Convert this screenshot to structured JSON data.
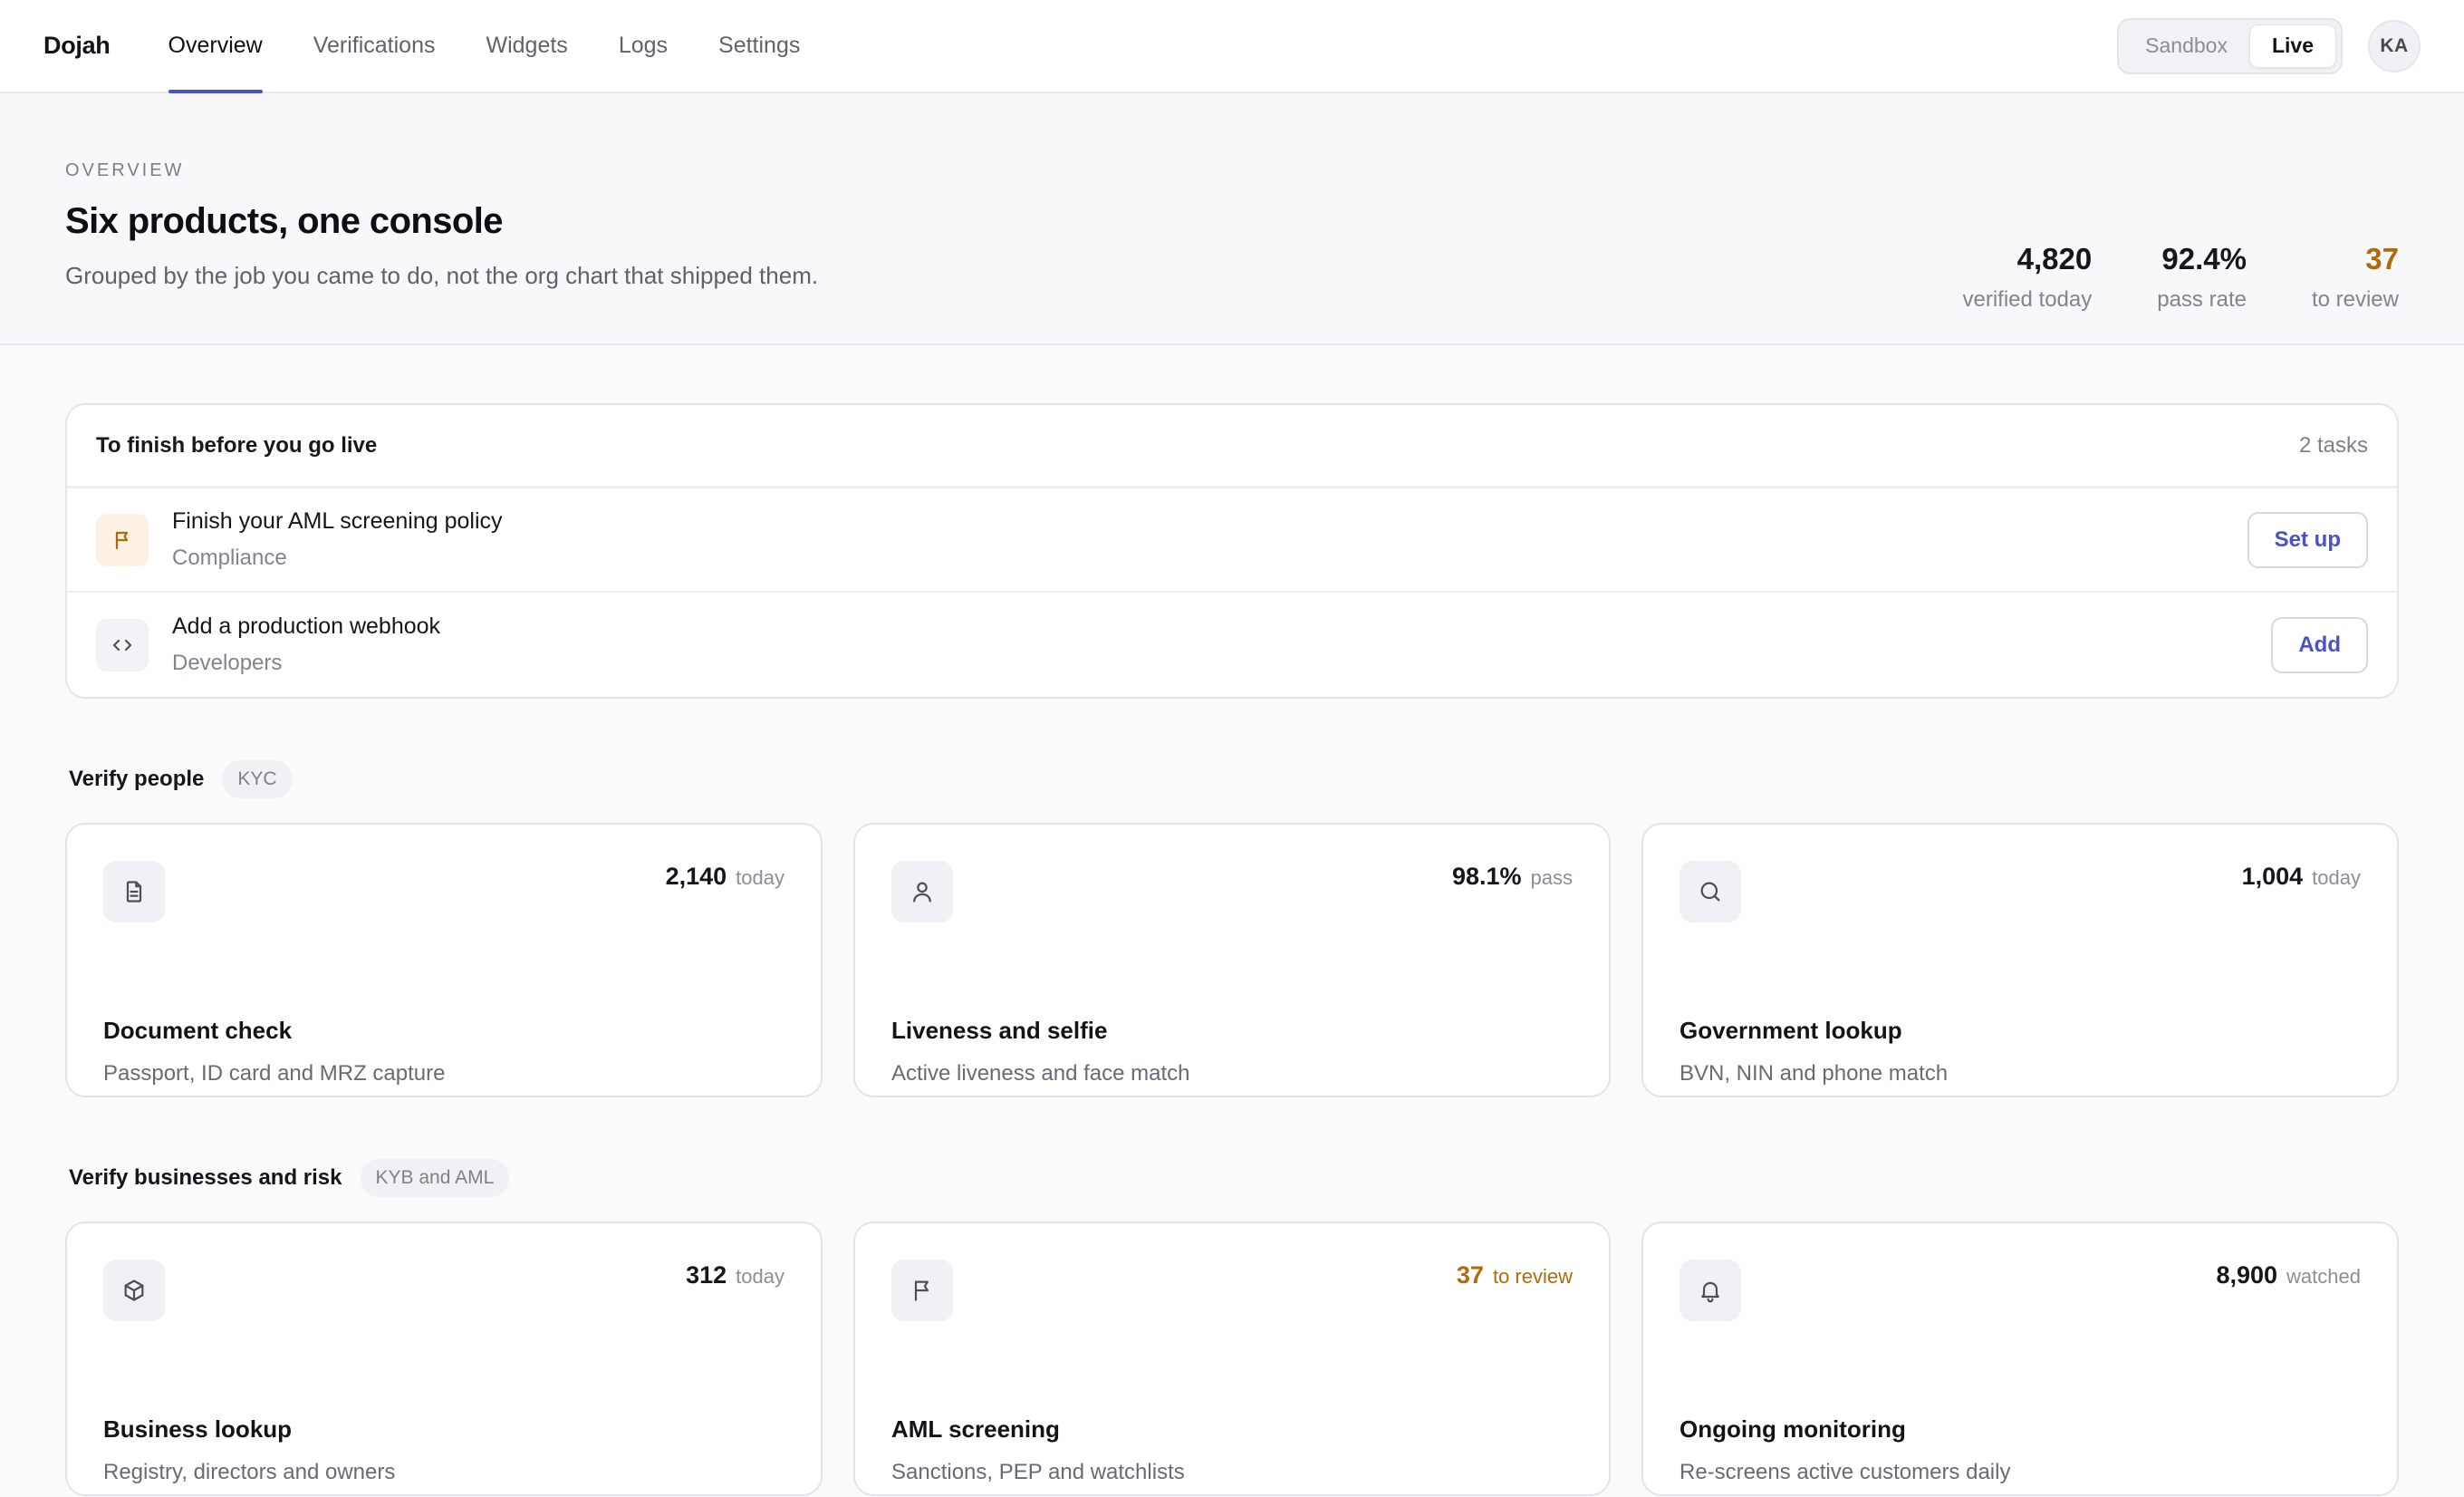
{
  "app": {
    "brand": "Dojah"
  },
  "nav": {
    "items": [
      {
        "label": "Overview",
        "active": true
      },
      {
        "label": "Verifications"
      },
      {
        "label": "Widgets"
      },
      {
        "label": "Logs"
      },
      {
        "label": "Settings"
      }
    ]
  },
  "environment": {
    "options": [
      "Sandbox",
      "Live"
    ],
    "selected": "Live"
  },
  "user": {
    "initials": "KA"
  },
  "hero": {
    "eyebrow": "OVERVIEW",
    "title": "Six products, one console",
    "subtitle": "Grouped by the job you came to do, not the org chart that shipped them."
  },
  "stats": [
    {
      "value": "4,820",
      "label": "verified today"
    },
    {
      "value": "92.4%",
      "label": "pass rate"
    },
    {
      "value": "37",
      "label": "to review",
      "color": "#b06a0a"
    }
  ],
  "tasks": {
    "title": "To finish before you go live",
    "count": "2 tasks",
    "items": [
      {
        "title": "Finish your AML screening policy",
        "category": "Compliance",
        "action": "Set up",
        "icon": "flag-icon"
      },
      {
        "title": "Add a production webhook",
        "category": "Developers",
        "action": "Add",
        "icon": "code-icon"
      }
    ]
  },
  "sections": [
    {
      "title": "Verify people",
      "tag": "KYC",
      "cards": [
        {
          "icon": "document-icon",
          "metric": "2,140",
          "unit": "today",
          "title": "Document check",
          "description": "Passport, ID card and MRZ capture"
        },
        {
          "icon": "user-icon",
          "metric": "98.1%",
          "unit": "pass",
          "title": "Liveness and selfie",
          "description": "Active liveness and face match"
        },
        {
          "icon": "search-icon",
          "metric": "1,004",
          "unit": "today",
          "title": "Government lookup",
          "description": "BVN, NIN and phone match"
        }
      ]
    },
    {
      "title": "Verify businesses and risk",
      "tag": "KYB and AML",
      "cards": [
        {
          "icon": "box-icon",
          "metric": "312",
          "unit": "today",
          "title": "Business lookup",
          "description": "Registry, directors and owners"
        },
        {
          "icon": "flag-icon",
          "metric": "37",
          "unit": "to review",
          "title": "AML screening",
          "description": "Sanctions, PEP and watchlists",
          "color": "#b06a0a"
        },
        {
          "icon": "bell-icon",
          "metric": "8,900",
          "unit": "watched",
          "title": "Ongoing monitoring",
          "description": "Re-screens active customers daily"
        }
      ]
    }
  ]
}
